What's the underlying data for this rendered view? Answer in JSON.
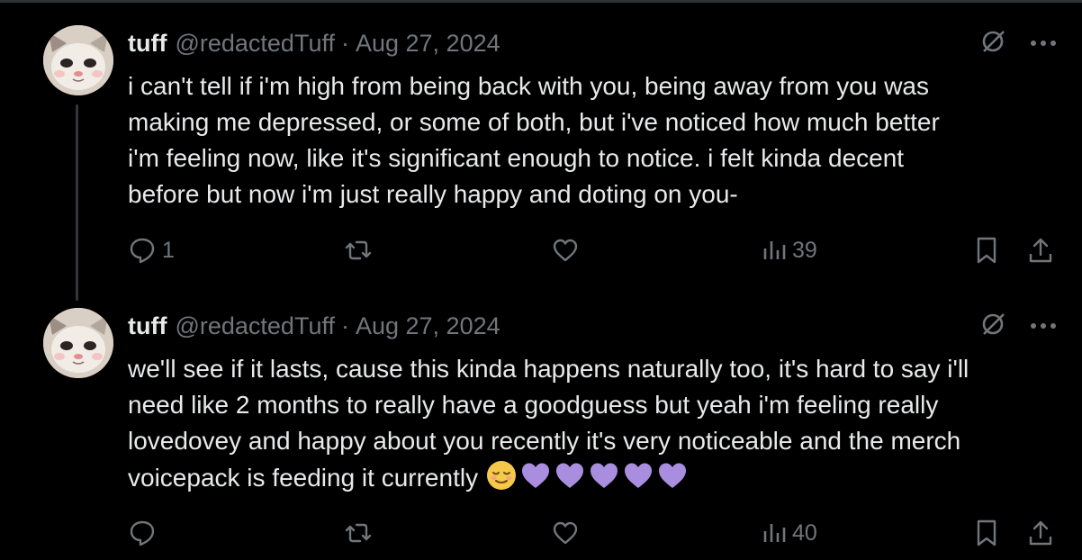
{
  "tweets": [
    {
      "name": "tuff",
      "handle": "@redactedTuff",
      "separator": "·",
      "date": "Aug 27, 2024",
      "text": "i can't tell if i'm high from being back with you, being away from you was\nmaking me depressed, or some of both, but i've noticed how much better\ni'm feeling now, like it's significant enough to notice. i felt kinda decent\nbefore but now i'm just really happy and doting on you-",
      "reply_count": "1",
      "repost_count": "",
      "like_count": "",
      "views": "39"
    },
    {
      "name": "tuff",
      "handle": "@redactedTuff",
      "separator": "·",
      "date": "Aug 27, 2024",
      "text": "we'll see if it lasts, cause this kinda happens naturally too, it's hard to say i'll\nneed like 2 months to really have a goodguess but yeah i'm feeling really\nlovedovey and happy about you recently it's very noticeable and the merch\nvoicepack is feeding it currently ",
      "emojis": [
        "relieved-face",
        "purple-heart",
        "purple-heart",
        "purple-heart",
        "purple-heart",
        "purple-heart"
      ],
      "reply_count": "",
      "repost_count": "",
      "like_count": "",
      "views": "40"
    }
  ],
  "colors": {
    "background": "#000000",
    "text": "#e7e9ea",
    "muted": "#71767b",
    "thread_line": "#333639",
    "purple_heart": "#a98ee0",
    "relieved_face": "#f7c94a"
  }
}
